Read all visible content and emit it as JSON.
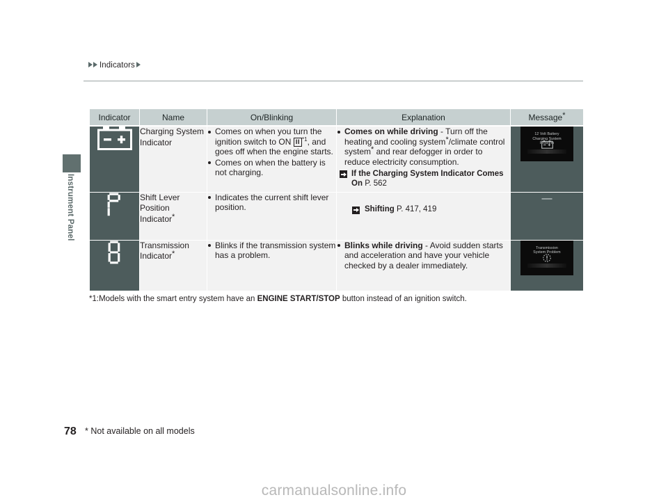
{
  "breadcrumb": {
    "label": "Indicators"
  },
  "sidebar": {
    "section_label": "Instrument Panel"
  },
  "table": {
    "headers": {
      "indicator": "Indicator",
      "name": "Name",
      "on_blinking": "On/Blinking",
      "explanation": "Explanation",
      "message": "Message",
      "message_star": "*"
    },
    "rows": [
      {
        "icon_name": "charging-system-battery-icon",
        "name": "Charging System Indicator",
        "name_star": "",
        "on_blinking": [
          {
            "pre": "Comes on when you turn the ignition switch to ON ",
            "key": "II",
            "sup": "*1",
            "post": ", and goes off when the engine starts."
          },
          {
            "text": "Comes on when the battery is not charging."
          }
        ],
        "explanation": {
          "bullet_bold": "Comes on while driving",
          "bullet_rest_a": " - Turn off the heating and cooling system",
          "star_a": "*",
          "bullet_rest_b": "/climate control system",
          "star_b": "*",
          "bullet_rest_c": " and rear defogger in order to reduce electricity consumption.",
          "reference_title": "If the Charging System Indicator Comes On",
          "reference_page": "P. 562"
        },
        "message": {
          "type": "screen",
          "screen_text": "12 Volt Battery\nCharging System\nProblem",
          "screen_icon": "battery-icon"
        }
      },
      {
        "icon_name": "shift-lever-position-p-icon",
        "name": "Shift Lever Position Indicator",
        "name_star": "*",
        "on_blinking": [
          {
            "text": "Indicates the current shift lever position."
          }
        ],
        "explanation": {
          "reference_title": "Shifting",
          "reference_page": "P. 417, 419"
        },
        "message": {
          "type": "dash",
          "dash_text": "—"
        }
      },
      {
        "icon_name": "transmission-d-icon",
        "name": "Transmission Indicator",
        "name_star": "*",
        "on_blinking": [
          {
            "text": "Blinks if the transmission system has a problem."
          }
        ],
        "explanation": {
          "bullet_bold": "Blinks while driving",
          "bullet_rest_a": " - Avoid sudden starts and acceleration and have your vehicle checked by a dealer immediately."
        },
        "message": {
          "type": "screen",
          "screen_text": "Transmission\nSystem Problem",
          "screen_icon": "transmission-warning-icon"
        }
      }
    ]
  },
  "footnote": {
    "prefix": "*1:Models with the smart entry system have an ",
    "bold": "ENGINE START/STOP",
    "suffix": " button instead of an ignition switch."
  },
  "footer": {
    "page_number": "78",
    "note": "* Not available on all models",
    "watermark": "carmanualsonline.info"
  },
  "colors": {
    "header_bg": "#c6d0d0",
    "icon_cell_bg": "#4d5c5c",
    "body_cell_bg": "#f2f2f2",
    "sidebar_tab": "#61706f",
    "text": "#231f20"
  }
}
